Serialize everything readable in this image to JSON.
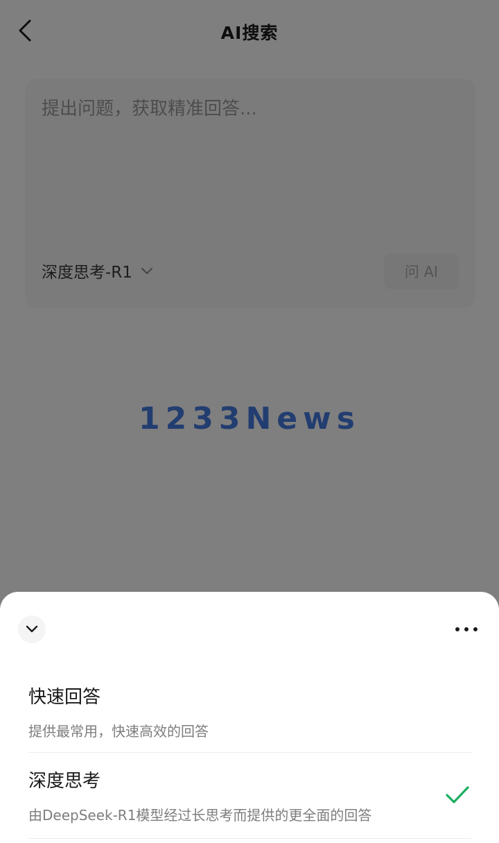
{
  "header": {
    "title": "AI搜索"
  },
  "query_card": {
    "placeholder": "提出问题，获取精准回答...",
    "model_selector_label": "深度思考-R1",
    "ask_button_label": "问 AI"
  },
  "watermark": "1233News",
  "sheet": {
    "options": [
      {
        "title": "快速回答",
        "description": "提供最常用，快速高效的回答",
        "selected": false
      },
      {
        "title": "深度思考",
        "description": "由DeepSeek-R1模型经过长思考而提供的更全面的回答",
        "selected": true
      }
    ]
  },
  "colors": {
    "accent_check": "#1aad5f",
    "watermark": "#3b74e0",
    "overlay": "rgba(0,0,0,0.5)"
  },
  "icons": {
    "back": "chevron-left-icon",
    "model_dropdown": "chevron-down-icon",
    "collapse": "chevron-down-icon",
    "more": "more-horizontal-icon",
    "selected": "check-icon"
  }
}
